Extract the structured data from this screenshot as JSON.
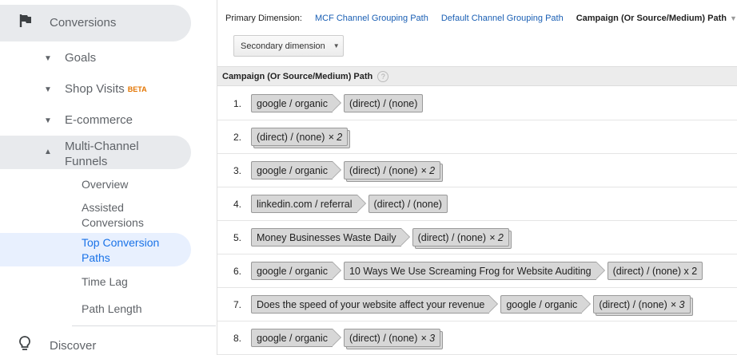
{
  "sidebar": {
    "conversions": "Conversions",
    "goals": "Goals",
    "shop_visits": "Shop Visits",
    "beta": "BETA",
    "ecommerce": "E-commerce",
    "mcf": "Multi-Channel Funnels",
    "overview": "Overview",
    "assisted": "Assisted Conversions",
    "top_paths": "Top Conversion Paths",
    "time_lag": "Time Lag",
    "path_length": "Path Length",
    "discover": "Discover"
  },
  "primary_dimension": {
    "label": "Primary Dimension:",
    "options": [
      "MCF Channel Grouping Path",
      "Default Channel Grouping Path"
    ],
    "selected": "Campaign (Or Source/Medium) Path"
  },
  "secondary_dimension": "Secondary dimension",
  "table": {
    "header": "Campaign (Or Source/Medium) Path",
    "help": "?",
    "rows": [
      {
        "num": "1.",
        "steps": [
          {
            "text": "google / organic"
          },
          {
            "text": "(direct) / (none)"
          }
        ]
      },
      {
        "num": "2.",
        "steps": [
          {
            "text": "(direct) / (none)",
            "mult": "× 2"
          }
        ]
      },
      {
        "num": "3.",
        "steps": [
          {
            "text": "google / organic"
          },
          {
            "text": "(direct) / (none)",
            "mult": "× 2"
          }
        ]
      },
      {
        "num": "4.",
        "steps": [
          {
            "text": "linkedin.com / referral"
          },
          {
            "text": "(direct) / (none)"
          }
        ]
      },
      {
        "num": "5.",
        "steps": [
          {
            "text": "Money Businesses Waste Daily"
          },
          {
            "text": "(direct) / (none)",
            "mult": "× 2"
          }
        ]
      },
      {
        "num": "6.",
        "steps": [
          {
            "text": "google / organic"
          },
          {
            "text": "10 Ways We Use Screaming Frog for Website Auditing"
          },
          {
            "text": "(direct) / (none) x 2"
          }
        ]
      },
      {
        "num": "7.",
        "steps": [
          {
            "text": "Does the speed of your website affect your revenue"
          },
          {
            "text": "google / organic"
          },
          {
            "text": "(direct) / (none)",
            "mult": "× 3"
          }
        ]
      },
      {
        "num": "8.",
        "steps": [
          {
            "text": "google / organic"
          },
          {
            "text": "(direct) / (none)",
            "mult": "× 3"
          }
        ]
      }
    ]
  },
  "colors": {
    "accent_link": "#1a5fb4",
    "active_bg": "#e8f0fe",
    "active_text": "#1a73e8",
    "beta": "#e37400"
  }
}
